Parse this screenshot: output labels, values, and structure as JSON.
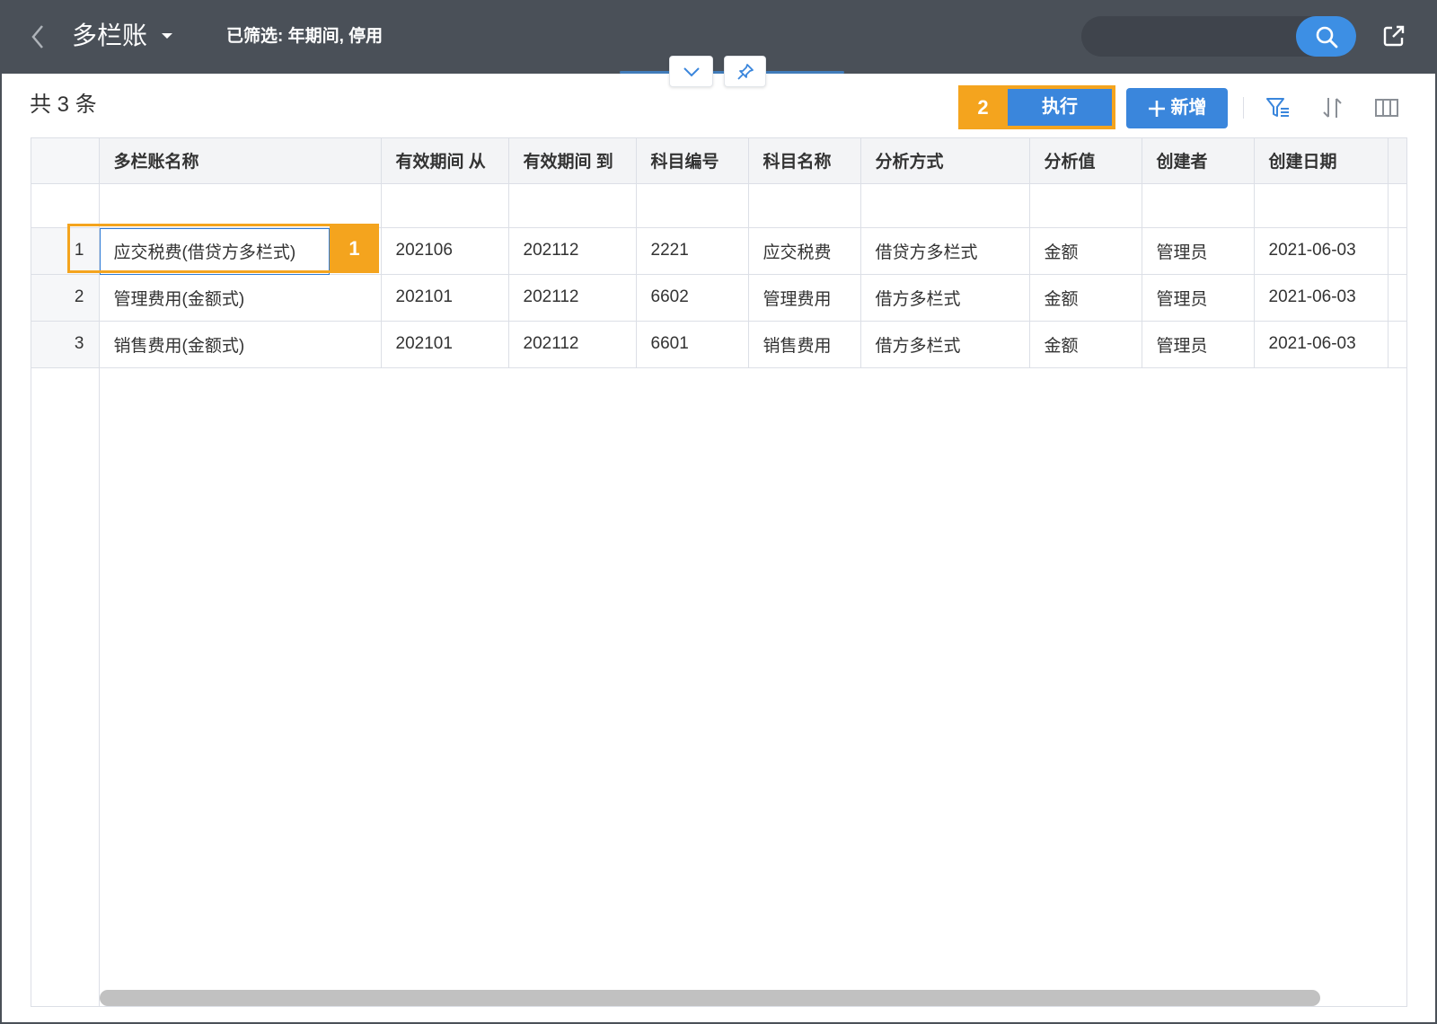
{
  "header": {
    "title": "多栏账",
    "filter_text": "已筛选: 年期间, 停用"
  },
  "summary": {
    "count_text": "共 3 条"
  },
  "toolbar": {
    "execute_label": "执行",
    "add_label": "新增"
  },
  "markers": {
    "m1": "1",
    "m2": "2"
  },
  "table": {
    "columns": [
      "多栏账名称",
      "有效期间 从",
      "有效期间 到",
      "科目编号",
      "科目名称",
      "分析方式",
      "分析值",
      "创建者",
      "创建日期"
    ],
    "rows": [
      {
        "index": "1",
        "name": "应交税费(借贷方多栏式)",
        "period_from": "202106",
        "period_to": "202112",
        "account_code": "2221",
        "account_name": "应交税费",
        "analysis_method": "借贷方多栏式",
        "analysis_value": "金额",
        "creator": "管理员",
        "created_date": "2021-06-03"
      },
      {
        "index": "2",
        "name": "管理费用(金额式)",
        "period_from": "202101",
        "period_to": "202112",
        "account_code": "6602",
        "account_name": "管理费用",
        "analysis_method": "借方多栏式",
        "analysis_value": "金额",
        "creator": "管理员",
        "created_date": "2021-06-03"
      },
      {
        "index": "3",
        "name": "销售费用(金额式)",
        "period_from": "202101",
        "period_to": "202112",
        "account_code": "6601",
        "account_name": "销售费用",
        "analysis_method": "借方多栏式",
        "analysis_value": "金额",
        "creator": "管理员",
        "created_date": "2021-06-03"
      }
    ]
  },
  "icons": {
    "back": "chevron-left-icon",
    "title_menu": "caret-down-icon",
    "search": "search-icon",
    "export": "export-icon",
    "collapse": "chevron-down-icon",
    "pin": "pin-icon",
    "add": "plus-icon",
    "filter": "filter-icon",
    "sort": "sort-icon",
    "columns": "columns-icon"
  },
  "colors": {
    "header_bg": "#4a5058",
    "primary": "#3a86dc",
    "link": "#2f7bd6",
    "marker": "#f4a41e",
    "border": "#dcdfe6"
  }
}
